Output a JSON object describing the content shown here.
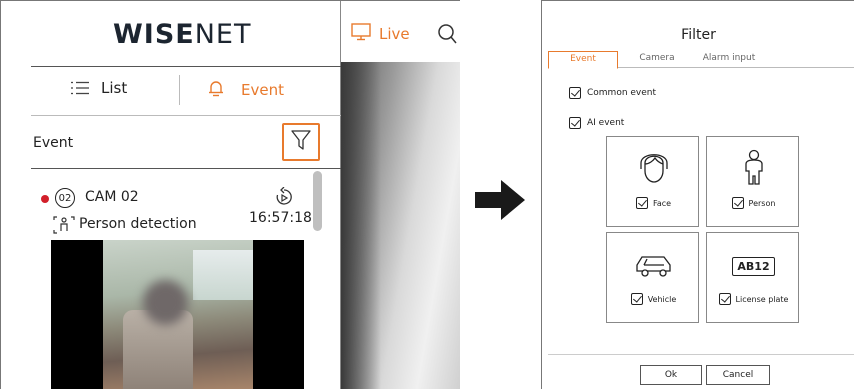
{
  "app": {
    "logo": {
      "bold": "WISE",
      "thin": "NET"
    },
    "live_label": "Live",
    "tabs": {
      "list": "List",
      "event": "Event"
    },
    "event_header": "Event",
    "event_item": {
      "cam_number": "02",
      "cam_name": "CAM 02",
      "detection": "Person detection",
      "time": "16:57:18"
    },
    "accent_color": "#e87a2d",
    "record_color": "#d21f2a"
  },
  "dialog": {
    "title": "Filter",
    "tabs": [
      "Event",
      "Camera",
      "Alarm input"
    ],
    "active_tab": "Event",
    "options": {
      "common_event": "Common event",
      "ai_event": "AI event"
    },
    "ai_types": [
      {
        "label": "Face",
        "icon": "face-icon",
        "checked": true
      },
      {
        "label": "Person",
        "icon": "person-icon",
        "checked": true
      },
      {
        "label": "Vehicle",
        "icon": "vehicle-icon",
        "checked": true
      },
      {
        "label": "License plate",
        "icon": "license-plate-icon",
        "checked": true,
        "plate_text": "AB12"
      }
    ],
    "buttons": {
      "ok": "Ok",
      "cancel": "Cancel"
    }
  }
}
